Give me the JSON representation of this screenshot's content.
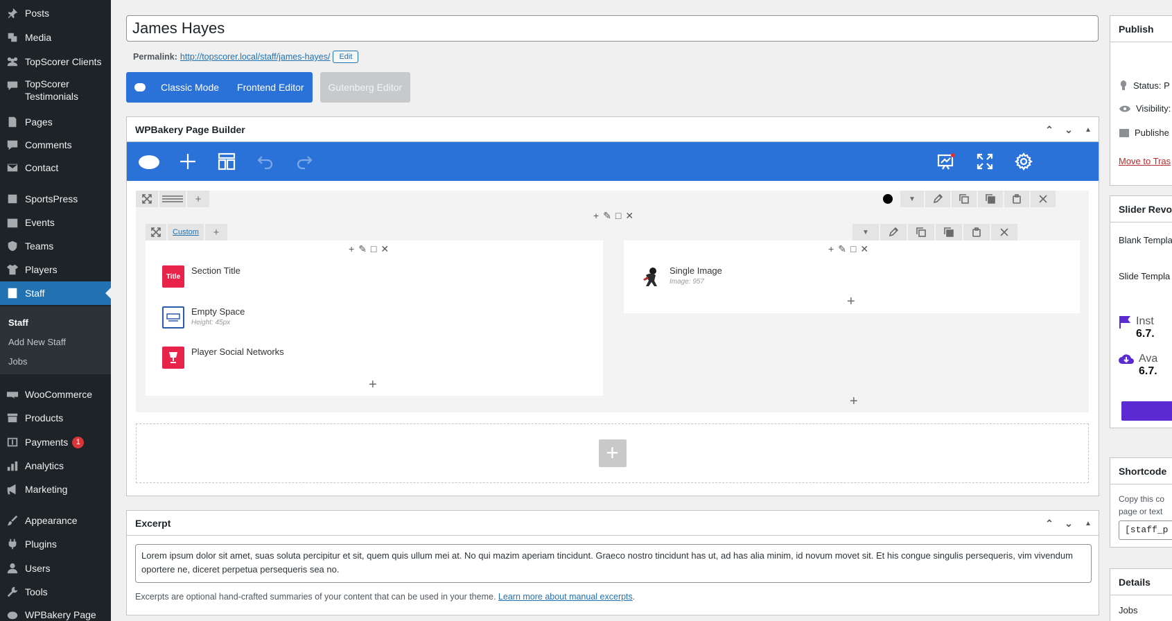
{
  "sidebar": {
    "items": [
      {
        "label": "Posts",
        "icon": "pin-icon"
      },
      {
        "label": "Media",
        "icon": "media-icon"
      },
      {
        "label": "TopScorer Clients",
        "icon": "groups-icon"
      },
      {
        "label": "TopScorer Testimonials",
        "icon": "testimonial-icon"
      },
      {
        "label": "Pages",
        "icon": "page-icon"
      },
      {
        "label": "Comments",
        "icon": "comment-icon"
      },
      {
        "label": "Contact",
        "icon": "mail-icon"
      },
      {
        "label": "SportsPress",
        "icon": "sportspress-icon"
      },
      {
        "label": "Events",
        "icon": "calendar-icon"
      },
      {
        "label": "Teams",
        "icon": "shield-icon"
      },
      {
        "label": "Players",
        "icon": "shirt-icon"
      },
      {
        "label": "Staff",
        "icon": "staff-icon"
      },
      {
        "label": "WooCommerce",
        "icon": "woocommerce-icon"
      },
      {
        "label": "Products",
        "icon": "archive-icon"
      },
      {
        "label": "Payments",
        "icon": "payments-icon",
        "badge": "1"
      },
      {
        "label": "Analytics",
        "icon": "chart-bar-icon"
      },
      {
        "label": "Marketing",
        "icon": "megaphone-icon"
      },
      {
        "label": "Appearance",
        "icon": "brush-icon"
      },
      {
        "label": "Plugins",
        "icon": "plug-icon"
      },
      {
        "label": "Users",
        "icon": "users-icon"
      },
      {
        "label": "Tools",
        "icon": "wrench-icon"
      },
      {
        "label": "WPBakery Page",
        "icon": "wpbakery-icon"
      }
    ],
    "submenu": [
      "Staff",
      "Add New Staff",
      "Jobs"
    ]
  },
  "post": {
    "title": "James Hayes",
    "permalink_label": "Permalink:",
    "permalink_url": "http://topscorer.local/staff/james-hayes/",
    "edit_label": "Edit"
  },
  "modes": {
    "classic": "Classic Mode",
    "frontend": "Frontend Editor",
    "gutenberg": "Gutenberg Editor"
  },
  "wpb": {
    "title": "WPBakery Page Builder",
    "inner_row_label": "Custom",
    "left_elements": [
      {
        "name": "Section Title",
        "sub": "",
        "icon_text": "Title",
        "color": "#e8234a"
      },
      {
        "name": "Empty Space",
        "sub": "Height: 45px",
        "icon_text": "",
        "color": "#2b5aa8"
      },
      {
        "name": "Player Social Networks",
        "sub": "",
        "icon_text": "",
        "color": "#e8234a"
      }
    ],
    "right_elements": [
      {
        "name": "Single Image",
        "sub": "Image: 957"
      }
    ]
  },
  "excerpt": {
    "title": "Excerpt",
    "text": "Lorem ipsum dolor sit amet, suas soluta percipitur et sit, quem quis ullum mei at. No qui mazim aperiam tincidunt. Graeco nostro tincidunt has ut, ad has alia minim, id novum movet sit. Et his congue singulis persequeris, vim vivendum oportere ne, diceret perpetua persequeris sea no.",
    "help_text": "Excerpts are optional hand-crafted summaries of your content that can be used in your theme.",
    "help_link": "Learn more about manual excerpts",
    "help_end": "."
  },
  "right": {
    "publish_title": "Publish",
    "status": "Status: P",
    "visibility": "Visibility:",
    "published": "Publishe",
    "trash": "Move to Tras",
    "slider_title": "Slider Revol",
    "blank_template": "Blank Templa",
    "slide_template": "Slide Templa",
    "installed_label": "Inst",
    "installed_version": "6.7.",
    "available_label": "Ava",
    "available_version": "6.7.",
    "shortcode_title": "Shortcode",
    "shortcode_help_1": "Copy this co",
    "shortcode_help_2": "page or text",
    "shortcode_value": "[staff_p",
    "details_title": "Details",
    "details_jobs": "Jobs"
  },
  "colors": {
    "admin_bg": "#1d2327",
    "accent": "#2271b1",
    "wpb_blue": "#2b72d8",
    "slider_purple": "#5b2ad0"
  }
}
